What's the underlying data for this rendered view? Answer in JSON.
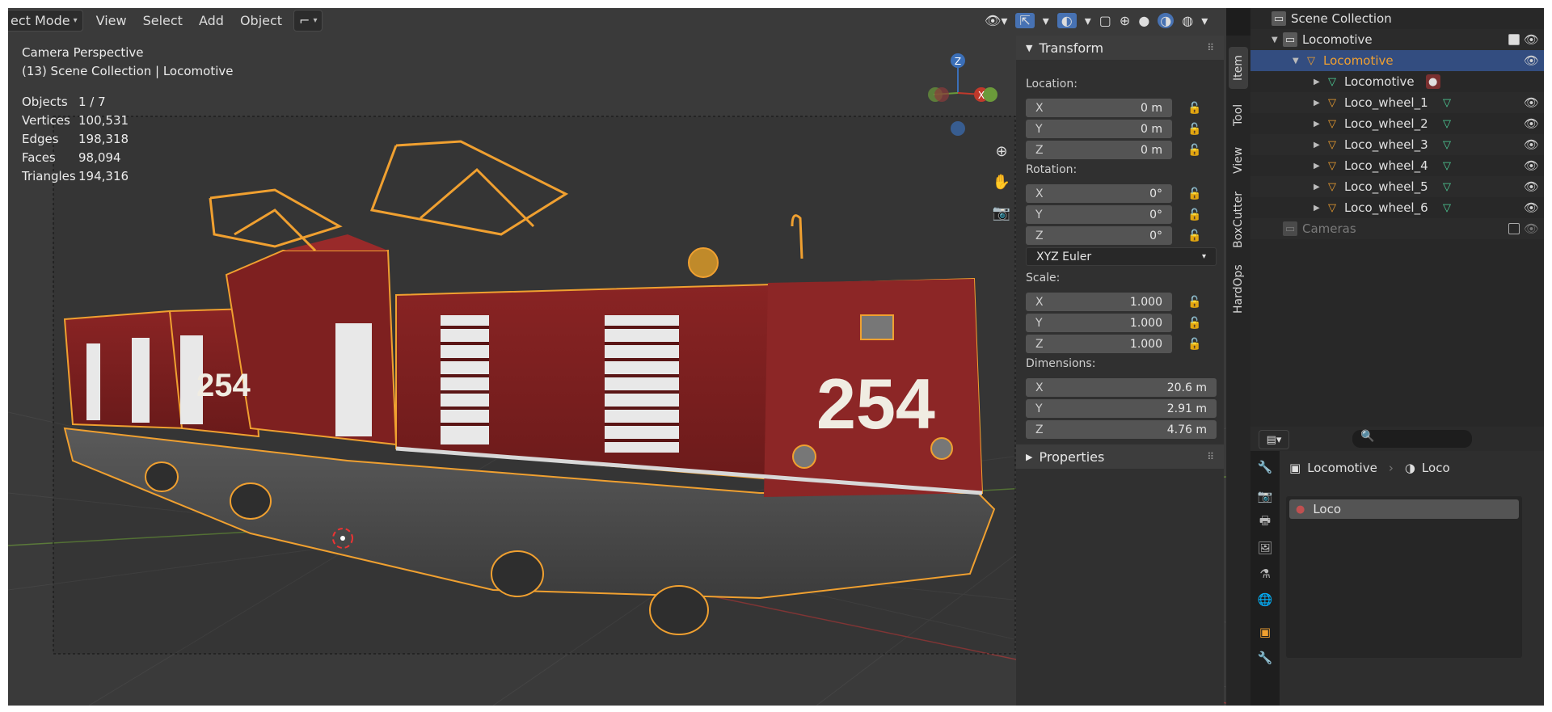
{
  "header": {
    "mode": "ect Mode",
    "menus": [
      "View",
      "Select",
      "Add",
      "Object"
    ]
  },
  "overlay": {
    "view_name": "Camera Perspective",
    "collection": "(13) Scene Collection | Locomotive",
    "stats": [
      {
        "label": "Objects",
        "value": "1 / 7"
      },
      {
        "label": "Vertices",
        "value": "100,531"
      },
      {
        "label": "Edges",
        "value": "198,318"
      },
      {
        "label": "Faces",
        "value": "98,094"
      },
      {
        "label": "Triangles",
        "value": "194,316"
      }
    ]
  },
  "gizmo": {
    "z": "Z",
    "x": "X"
  },
  "model": {
    "number_left": "254",
    "number_right": "254"
  },
  "npanel": {
    "transform_title": "Transform",
    "location_label": "Location:",
    "location": [
      {
        "axis": "X",
        "value": "0 m"
      },
      {
        "axis": "Y",
        "value": "0 m"
      },
      {
        "axis": "Z",
        "value": "0 m"
      }
    ],
    "rotation_label": "Rotation:",
    "rotation": [
      {
        "axis": "X",
        "value": "0°"
      },
      {
        "axis": "Y",
        "value": "0°"
      },
      {
        "axis": "Z",
        "value": "0°"
      }
    ],
    "rotation_mode": "XYZ Euler",
    "scale_label": "Scale:",
    "scale": [
      {
        "axis": "X",
        "value": "1.000"
      },
      {
        "axis": "Y",
        "value": "1.000"
      },
      {
        "axis": "Z",
        "value": "1.000"
      }
    ],
    "dimensions_label": "Dimensions:",
    "dimensions": [
      {
        "axis": "X",
        "value": "20.6 m"
      },
      {
        "axis": "Y",
        "value": "2.91 m"
      },
      {
        "axis": "Z",
        "value": "4.76 m"
      }
    ],
    "properties_title": "Properties",
    "tabs": [
      "Item",
      "Tool",
      "View",
      "BoxCutter",
      "HardOps"
    ]
  },
  "outliner": {
    "root": "Scene Collection",
    "collection": "Locomotive",
    "selected_object": "Locomotive",
    "mesh_data": "Locomotive",
    "children": [
      "Loco_wheel_1",
      "Loco_wheel_2",
      "Loco_wheel_3",
      "Loco_wheel_4",
      "Loco_wheel_5",
      "Loco_wheel_6"
    ],
    "cameras": "Cameras"
  },
  "properties": {
    "breadcrumb_object": "Locomotive",
    "breadcrumb_material": "Loco",
    "material_slot": "Loco"
  },
  "colors": {
    "selection_outline": "#f0a030",
    "body_red": "#7a1e1e",
    "active_row": "#334d80"
  }
}
